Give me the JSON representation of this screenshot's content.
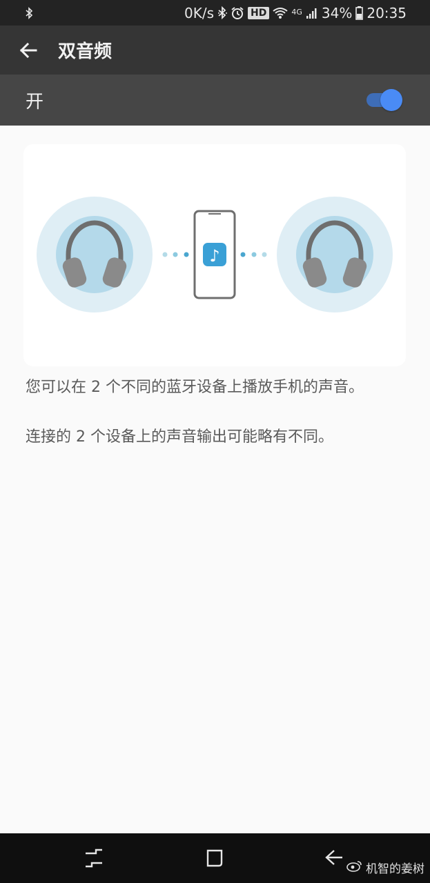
{
  "status_bar": {
    "net_speed": "0K/s",
    "hd": "HD",
    "network": "4G",
    "battery": "34%",
    "time": "20:35"
  },
  "app_bar": {
    "title": "双音频"
  },
  "toggle": {
    "label": "开",
    "state": "on",
    "accent": "#4a8bf5"
  },
  "description": {
    "line1": "您可以在 2 个不同的蓝牙设备上播放手机的声音。",
    "line2": "连接的 2 个设备上的声音输出可能略有不同。"
  },
  "watermark": {
    "text": "机智的姜树"
  }
}
